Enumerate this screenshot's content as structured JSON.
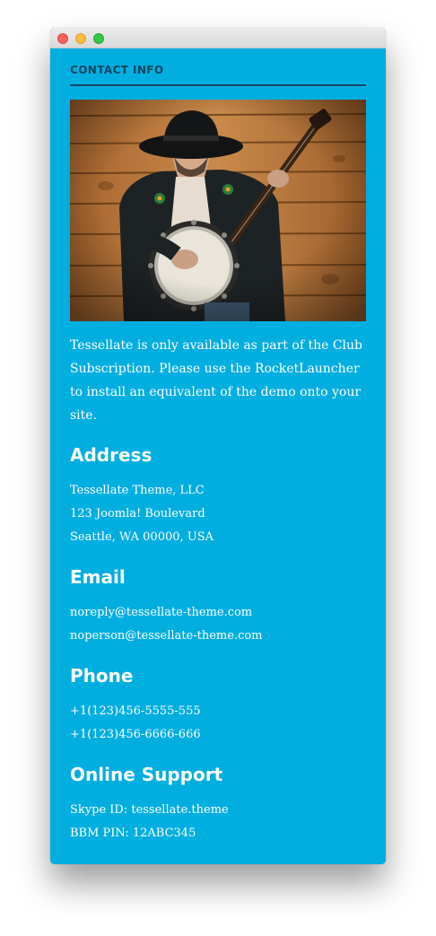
{
  "section_header": "CONTACT INFO",
  "photo": {
    "description_icon": "banjo-player-photo"
  },
  "intro_text": "Tessellate is only available as part of the Club Subscription. Please use the RocketLauncher to install an equivalent of the demo onto your site.",
  "address": {
    "title": "Address",
    "lines": [
      "Tessellate Theme, LLC",
      "123 Joomla! Boulevard",
      "Seattle, WA 00000, USA"
    ]
  },
  "email": {
    "title": "Email",
    "lines": [
      "noreply@tessellate-theme.com",
      "noperson@tessellate-theme.com"
    ]
  },
  "phone": {
    "title": "Phone",
    "lines": [
      "+1(123)456-5555-555",
      "+1(123)456-6666-666"
    ]
  },
  "online_support": {
    "title": "Online Support",
    "lines": [
      "Skype ID: tessellate.theme",
      "BBM PIN: 12ABC345"
    ]
  },
  "colors": {
    "background": "#00aee0",
    "header_text": "#0c4761",
    "body_text": "#ffffff"
  }
}
